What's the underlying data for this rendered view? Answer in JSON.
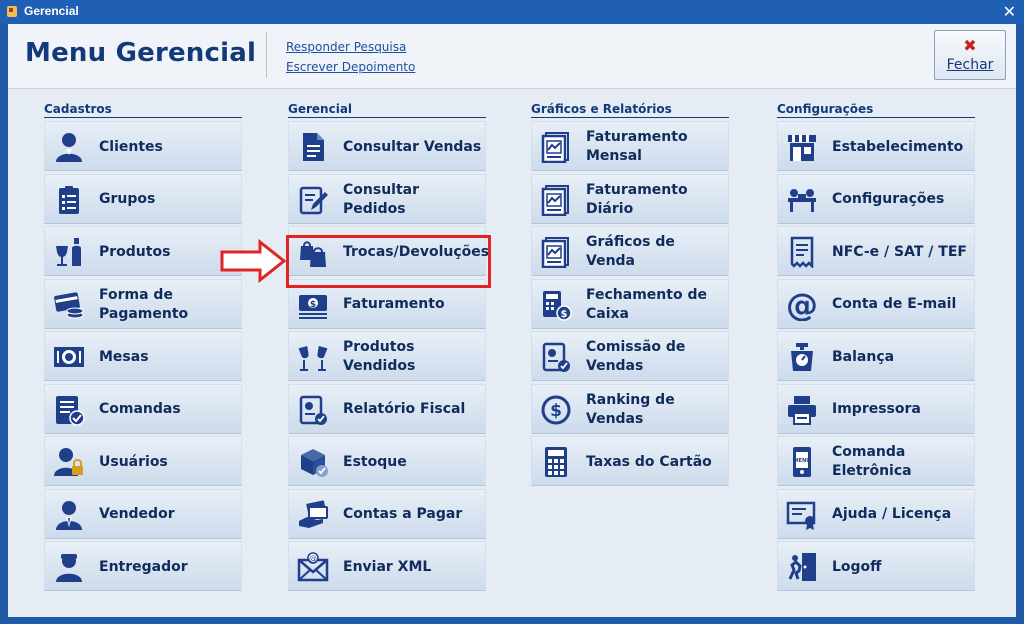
{
  "window": {
    "title": "Gerencial",
    "close_glyph": "✕"
  },
  "header": {
    "title": "Menu Gerencial",
    "links": [
      "Responder Pesquisa",
      "Escrever Depoimento"
    ],
    "close_button": {
      "label": "Fechar",
      "icon": "close-x-icon",
      "icon_color": "#c8201f"
    }
  },
  "columns": [
    {
      "title": "Cadastros",
      "items": [
        {
          "label": "Clientes",
          "icon": "person-icon"
        },
        {
          "label": "Grupos",
          "icon": "clipboard-list-icon"
        },
        {
          "label": "Produtos",
          "icon": "wine-bottle-icon"
        },
        {
          "label": "Forma de Pagamento",
          "icon": "card-coins-icon"
        },
        {
          "label": "Mesas",
          "icon": "plate-icon"
        },
        {
          "label": "Comandas",
          "icon": "list-check-icon"
        },
        {
          "label": "Usuários",
          "icon": "user-lock-icon"
        },
        {
          "label": "Vendedor",
          "icon": "salesman-icon"
        },
        {
          "label": "Entregador",
          "icon": "delivery-person-icon"
        }
      ]
    },
    {
      "title": "Gerencial",
      "items": [
        {
          "label": "Consultar Vendas",
          "icon": "document-icon"
        },
        {
          "label": "Consultar Pedidos",
          "icon": "edit-document-icon"
        },
        {
          "label": "Trocas/Devoluções",
          "icon": "shopping-bags-icon"
        },
        {
          "label": "Faturamento",
          "icon": "money-bill-icon"
        },
        {
          "label": "Produtos Vendidos",
          "icon": "glasses-cheers-icon"
        },
        {
          "label": "Relatório Fiscal",
          "icon": "report-check-icon"
        },
        {
          "label": "Estoque",
          "icon": "box-check-icon"
        },
        {
          "label": "Contas a Pagar",
          "icon": "hand-cards-icon"
        },
        {
          "label": "Enviar XML",
          "icon": "envelope-at-icon"
        }
      ]
    },
    {
      "title": "Gráficos e Relatórios",
      "items": [
        {
          "label": "Faturamento Mensal",
          "icon": "chart-document-icon"
        },
        {
          "label": "Faturamento Diário",
          "icon": "chart-document-icon"
        },
        {
          "label": "Gráficos de Venda",
          "icon": "chart-document-icon"
        },
        {
          "label": "Fechamento de Caixa",
          "icon": "calculator-coin-icon"
        },
        {
          "label": "Comissão de Vendas",
          "icon": "report-check-icon"
        },
        {
          "label": "Ranking de Vendas",
          "icon": "dollar-circle-icon"
        },
        {
          "label": "Taxas do Cartão",
          "icon": "calculator-icon"
        }
      ]
    },
    {
      "title": "Configurações",
      "items": [
        {
          "label": "Estabelecimento",
          "icon": "store-icon"
        },
        {
          "label": "Configurações",
          "icon": "people-desk-icon"
        },
        {
          "label": "NFC-e / SAT / TEF",
          "icon": "receipt-icon"
        },
        {
          "label": "Conta de E-mail",
          "icon": "at-sign-icon"
        },
        {
          "label": "Balança",
          "icon": "scale-icon"
        },
        {
          "label": "Impressora",
          "icon": "printer-icon"
        },
        {
          "label": "Comanda Eletrônica",
          "icon": "mobile-menu-icon"
        },
        {
          "label": "Ajuda / Licença",
          "icon": "certificate-icon"
        },
        {
          "label": "Logoff",
          "icon": "exit-door-icon"
        }
      ]
    }
  ],
  "highlight": {
    "target": "Consultar Pedidos",
    "color": "#e02424"
  },
  "colors": {
    "accent": "#123a7a",
    "icon": "#1f3f8a",
    "titlebar": "#1f5fb4"
  }
}
